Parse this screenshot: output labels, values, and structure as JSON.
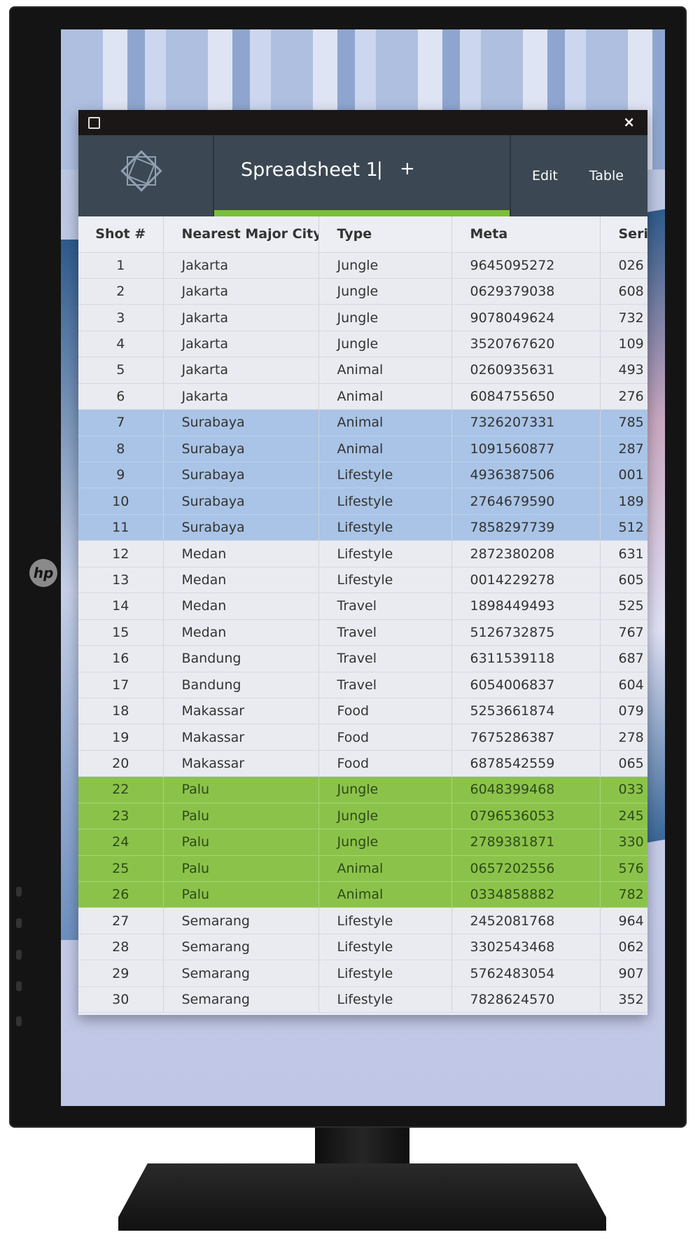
{
  "window": {
    "maximize_icon": "square-icon",
    "close_label": "×"
  },
  "header": {
    "logo_icon": "star-octagon-logo",
    "tab_title": "Spreadsheet 1",
    "tab_separator": "|",
    "add_tab_label": "+",
    "menu": [
      "Edit",
      "Table"
    ],
    "accent": "#78c134"
  },
  "monitor": {
    "brand_logo": "hp"
  },
  "table": {
    "columns": [
      "Shot #",
      "Nearest Major City",
      "Type",
      "Meta",
      "Seri"
    ],
    "highlight_colors": {
      "blue": "#a9c4e6",
      "green": "#8bc34a"
    },
    "rows": [
      {
        "cells": [
          "1",
          "Jakarta",
          "Jungle",
          "9645095272",
          "026"
        ],
        "hl": ""
      },
      {
        "cells": [
          "2",
          "Jakarta",
          "Jungle",
          "0629379038",
          "608"
        ],
        "hl": ""
      },
      {
        "cells": [
          "3",
          "Jakarta",
          "Jungle",
          "9078049624",
          "732"
        ],
        "hl": ""
      },
      {
        "cells": [
          "4",
          "Jakarta",
          "Jungle",
          "3520767620",
          "109"
        ],
        "hl": ""
      },
      {
        "cells": [
          "5",
          "Jakarta",
          "Animal",
          "0260935631",
          "493"
        ],
        "hl": ""
      },
      {
        "cells": [
          "6",
          "Jakarta",
          "Animal",
          "6084755650",
          "276"
        ],
        "hl": ""
      },
      {
        "cells": [
          "7",
          "Surabaya",
          "Animal",
          "7326207331",
          "785"
        ],
        "hl": "blue"
      },
      {
        "cells": [
          "8",
          "Surabaya",
          "Animal",
          "1091560877",
          "287"
        ],
        "hl": "blue"
      },
      {
        "cells": [
          "9",
          "Surabaya",
          "Lifestyle",
          "4936387506",
          "001"
        ],
        "hl": "blue"
      },
      {
        "cells": [
          "10",
          "Surabaya",
          "Lifestyle",
          "2764679590",
          "189"
        ],
        "hl": "blue"
      },
      {
        "cells": [
          "11",
          "Surabaya",
          "Lifestyle",
          "7858297739",
          "512"
        ],
        "hl": "blue"
      },
      {
        "cells": [
          "12",
          "Medan",
          "Lifestyle",
          "2872380208",
          "631"
        ],
        "hl": ""
      },
      {
        "cells": [
          "13",
          "Medan",
          "Lifestyle",
          "0014229278",
          "605"
        ],
        "hl": ""
      },
      {
        "cells": [
          "14",
          "Medan",
          "Travel",
          "1898449493",
          "525"
        ],
        "hl": ""
      },
      {
        "cells": [
          "15",
          "Medan",
          "Travel",
          "5126732875",
          "767"
        ],
        "hl": ""
      },
      {
        "cells": [
          "16",
          "Bandung",
          "Travel",
          "6311539118",
          "687"
        ],
        "hl": ""
      },
      {
        "cells": [
          "17",
          "Bandung",
          "Travel",
          "6054006837",
          "604"
        ],
        "hl": ""
      },
      {
        "cells": [
          "18",
          "Makassar",
          "Food",
          "5253661874",
          "079"
        ],
        "hl": ""
      },
      {
        "cells": [
          "19",
          "Makassar",
          "Food",
          "7675286387",
          "278"
        ],
        "hl": ""
      },
      {
        "cells": [
          "20",
          "Makassar",
          "Food",
          "6878542559",
          "065"
        ],
        "hl": ""
      },
      {
        "cells": [
          "22",
          "Palu",
          "Jungle",
          "6048399468",
          "033"
        ],
        "hl": "green"
      },
      {
        "cells": [
          "23",
          "Palu",
          "Jungle",
          "0796536053",
          "245"
        ],
        "hl": "green"
      },
      {
        "cells": [
          "24",
          "Palu",
          "Jungle",
          "2789381871",
          "330"
        ],
        "hl": "green"
      },
      {
        "cells": [
          "25",
          "Palu",
          "Animal",
          "0657202556",
          "576"
        ],
        "hl": "green"
      },
      {
        "cells": [
          "26",
          "Palu",
          "Animal",
          "0334858882",
          "782"
        ],
        "hl": "green"
      },
      {
        "cells": [
          "27",
          "Semarang",
          "Lifestyle",
          "2452081768",
          "964"
        ],
        "hl": ""
      },
      {
        "cells": [
          "28",
          "Semarang",
          "Lifestyle",
          "3302543468",
          "062"
        ],
        "hl": ""
      },
      {
        "cells": [
          "29",
          "Semarang",
          "Lifestyle",
          "5762483054",
          "907"
        ],
        "hl": ""
      },
      {
        "cells": [
          "30",
          "Semarang",
          "Lifestyle",
          "7828624570",
          "352"
        ],
        "hl": ""
      }
    ]
  }
}
